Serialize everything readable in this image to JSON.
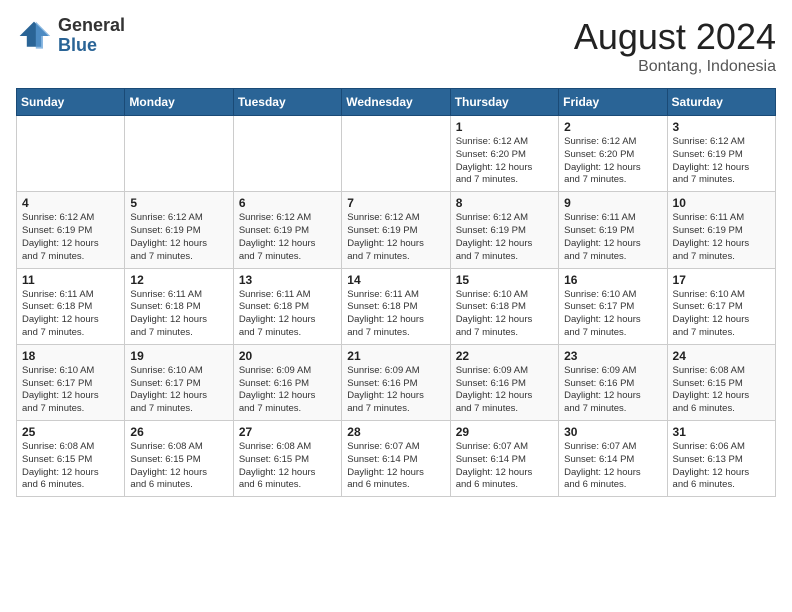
{
  "header": {
    "logo_line1": "General",
    "logo_line2": "Blue",
    "month_year": "August 2024",
    "location": "Bontang, Indonesia"
  },
  "weekdays": [
    "Sunday",
    "Monday",
    "Tuesday",
    "Wednesday",
    "Thursday",
    "Friday",
    "Saturday"
  ],
  "weeks": [
    [
      {
        "day": "",
        "info": ""
      },
      {
        "day": "",
        "info": ""
      },
      {
        "day": "",
        "info": ""
      },
      {
        "day": "",
        "info": ""
      },
      {
        "day": "1",
        "info": "Sunrise: 6:12 AM\nSunset: 6:20 PM\nDaylight: 12 hours\nand 7 minutes."
      },
      {
        "day": "2",
        "info": "Sunrise: 6:12 AM\nSunset: 6:20 PM\nDaylight: 12 hours\nand 7 minutes."
      },
      {
        "day": "3",
        "info": "Sunrise: 6:12 AM\nSunset: 6:19 PM\nDaylight: 12 hours\nand 7 minutes."
      }
    ],
    [
      {
        "day": "4",
        "info": "Sunrise: 6:12 AM\nSunset: 6:19 PM\nDaylight: 12 hours\nand 7 minutes."
      },
      {
        "day": "5",
        "info": "Sunrise: 6:12 AM\nSunset: 6:19 PM\nDaylight: 12 hours\nand 7 minutes."
      },
      {
        "day": "6",
        "info": "Sunrise: 6:12 AM\nSunset: 6:19 PM\nDaylight: 12 hours\nand 7 minutes."
      },
      {
        "day": "7",
        "info": "Sunrise: 6:12 AM\nSunset: 6:19 PM\nDaylight: 12 hours\nand 7 minutes."
      },
      {
        "day": "8",
        "info": "Sunrise: 6:12 AM\nSunset: 6:19 PM\nDaylight: 12 hours\nand 7 minutes."
      },
      {
        "day": "9",
        "info": "Sunrise: 6:11 AM\nSunset: 6:19 PM\nDaylight: 12 hours\nand 7 minutes."
      },
      {
        "day": "10",
        "info": "Sunrise: 6:11 AM\nSunset: 6:19 PM\nDaylight: 12 hours\nand 7 minutes."
      }
    ],
    [
      {
        "day": "11",
        "info": "Sunrise: 6:11 AM\nSunset: 6:18 PM\nDaylight: 12 hours\nand 7 minutes."
      },
      {
        "day": "12",
        "info": "Sunrise: 6:11 AM\nSunset: 6:18 PM\nDaylight: 12 hours\nand 7 minutes."
      },
      {
        "day": "13",
        "info": "Sunrise: 6:11 AM\nSunset: 6:18 PM\nDaylight: 12 hours\nand 7 minutes."
      },
      {
        "day": "14",
        "info": "Sunrise: 6:11 AM\nSunset: 6:18 PM\nDaylight: 12 hours\nand 7 minutes."
      },
      {
        "day": "15",
        "info": "Sunrise: 6:10 AM\nSunset: 6:18 PM\nDaylight: 12 hours\nand 7 minutes."
      },
      {
        "day": "16",
        "info": "Sunrise: 6:10 AM\nSunset: 6:17 PM\nDaylight: 12 hours\nand 7 minutes."
      },
      {
        "day": "17",
        "info": "Sunrise: 6:10 AM\nSunset: 6:17 PM\nDaylight: 12 hours\nand 7 minutes."
      }
    ],
    [
      {
        "day": "18",
        "info": "Sunrise: 6:10 AM\nSunset: 6:17 PM\nDaylight: 12 hours\nand 7 minutes."
      },
      {
        "day": "19",
        "info": "Sunrise: 6:10 AM\nSunset: 6:17 PM\nDaylight: 12 hours\nand 7 minutes."
      },
      {
        "day": "20",
        "info": "Sunrise: 6:09 AM\nSunset: 6:16 PM\nDaylight: 12 hours\nand 7 minutes."
      },
      {
        "day": "21",
        "info": "Sunrise: 6:09 AM\nSunset: 6:16 PM\nDaylight: 12 hours\nand 7 minutes."
      },
      {
        "day": "22",
        "info": "Sunrise: 6:09 AM\nSunset: 6:16 PM\nDaylight: 12 hours\nand 7 minutes."
      },
      {
        "day": "23",
        "info": "Sunrise: 6:09 AM\nSunset: 6:16 PM\nDaylight: 12 hours\nand 7 minutes."
      },
      {
        "day": "24",
        "info": "Sunrise: 6:08 AM\nSunset: 6:15 PM\nDaylight: 12 hours\nand 6 minutes."
      }
    ],
    [
      {
        "day": "25",
        "info": "Sunrise: 6:08 AM\nSunset: 6:15 PM\nDaylight: 12 hours\nand 6 minutes."
      },
      {
        "day": "26",
        "info": "Sunrise: 6:08 AM\nSunset: 6:15 PM\nDaylight: 12 hours\nand 6 minutes."
      },
      {
        "day": "27",
        "info": "Sunrise: 6:08 AM\nSunset: 6:15 PM\nDaylight: 12 hours\nand 6 minutes."
      },
      {
        "day": "28",
        "info": "Sunrise: 6:07 AM\nSunset: 6:14 PM\nDaylight: 12 hours\nand 6 minutes."
      },
      {
        "day": "29",
        "info": "Sunrise: 6:07 AM\nSunset: 6:14 PM\nDaylight: 12 hours\nand 6 minutes."
      },
      {
        "day": "30",
        "info": "Sunrise: 6:07 AM\nSunset: 6:14 PM\nDaylight: 12 hours\nand 6 minutes."
      },
      {
        "day": "31",
        "info": "Sunrise: 6:06 AM\nSunset: 6:13 PM\nDaylight: 12 hours\nand 6 minutes."
      }
    ]
  ]
}
